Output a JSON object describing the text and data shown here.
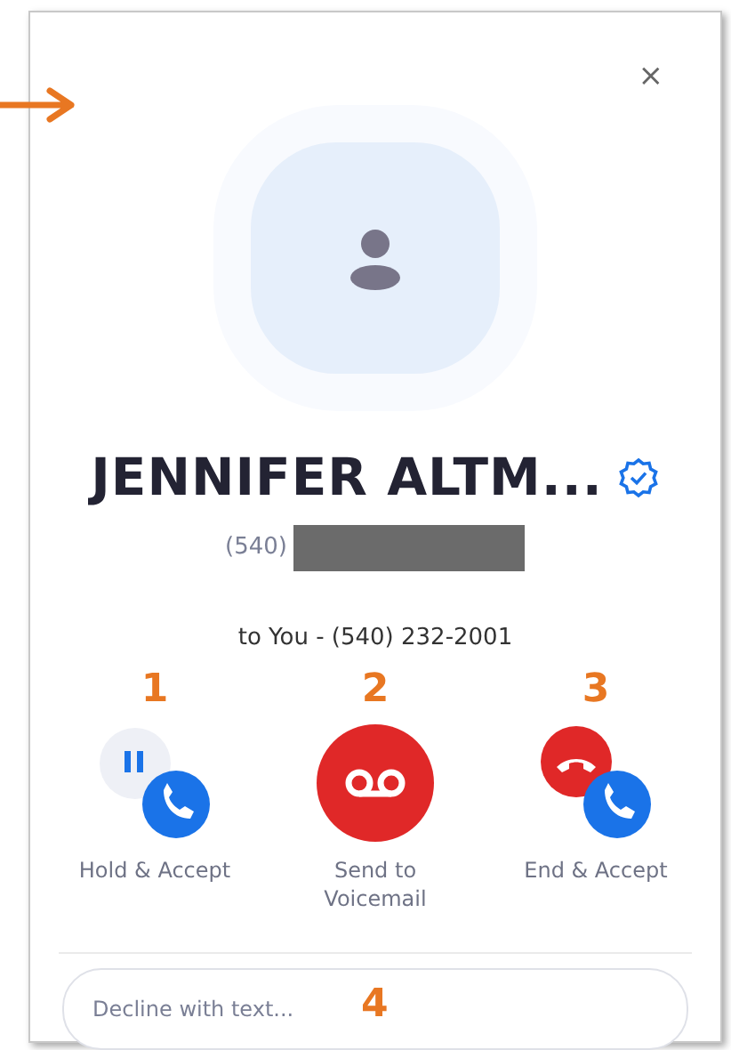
{
  "window": {
    "close_label": "×"
  },
  "caller": {
    "name": "JENNIFER ALTM...",
    "verified": true,
    "number_prefix": "(540)",
    "number_redacted": true,
    "line": "to You - (540) 232-2001"
  },
  "actions": [
    {
      "kind": "hold",
      "label": "Hold & Accept",
      "marker": "1"
    },
    {
      "kind": "voicemail",
      "label": "Send to Voicemail",
      "marker": "2"
    },
    {
      "kind": "end",
      "label": "End & Accept",
      "marker": "3"
    }
  ],
  "decline": {
    "placeholder": "Decline with text...",
    "marker": "4"
  },
  "pointer_arrow": true
}
